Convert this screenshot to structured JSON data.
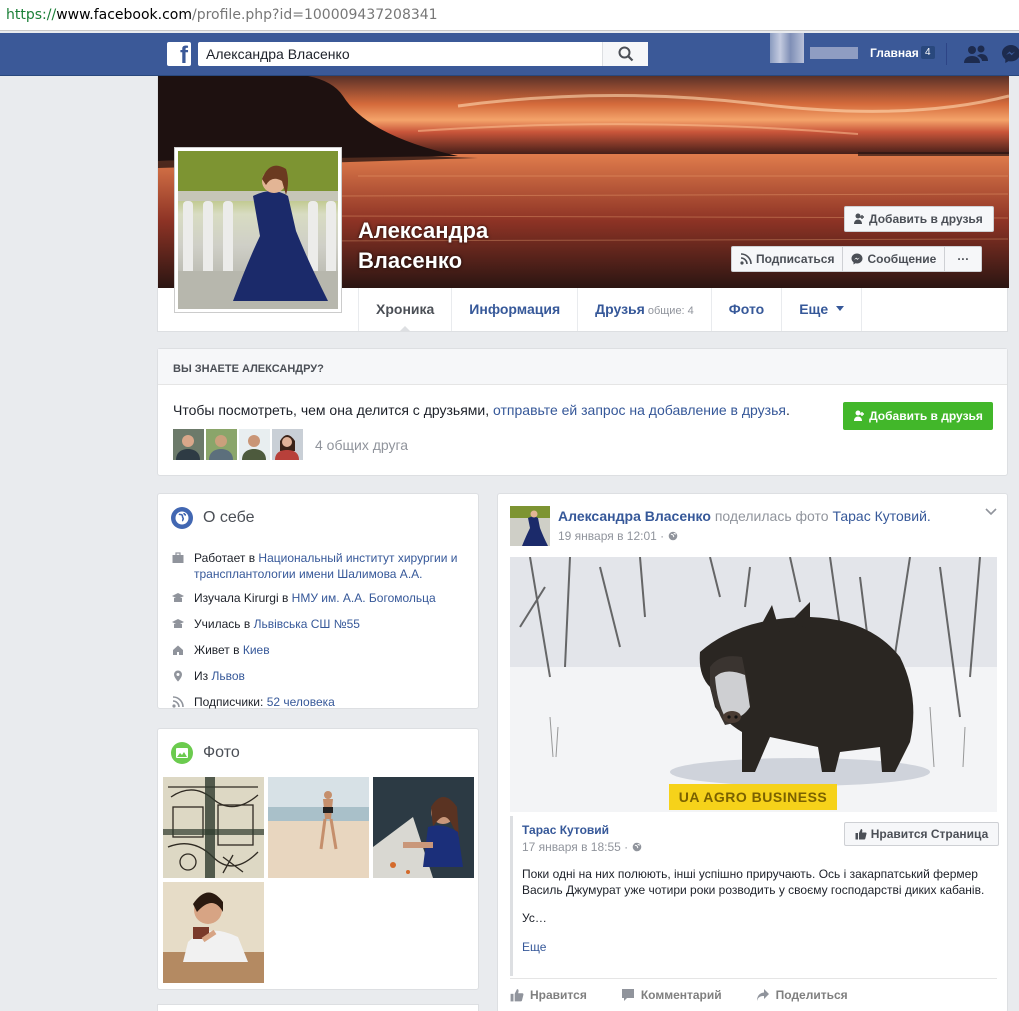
{
  "browser": {
    "url_proto": "https://",
    "url_host": "www.facebook.com",
    "url_path": "/profile.php?id=100009437208341"
  },
  "topnav": {
    "logo": "f",
    "search_value": "Александра Власенко",
    "home_label": "Главная",
    "home_count": "4",
    "icons": [
      "search-icon",
      "friend-requests-icon",
      "messages-icon"
    ]
  },
  "profile": {
    "name_line1": "Александра",
    "name_line2": "Власенко",
    "add_friend_label": "Добавить в друзья",
    "follow_label": "Подписаться",
    "message_label": "Сообщение",
    "more_label": "···"
  },
  "tabs": [
    {
      "label": "Хроника",
      "sub": ""
    },
    {
      "label": "Информация",
      "sub": ""
    },
    {
      "label": "Друзья",
      "sub": "общие: 4"
    },
    {
      "label": "Фото",
      "sub": ""
    },
    {
      "label": "Еще",
      "sub": ""
    }
  ],
  "know": {
    "heading": "ВЫ ЗНАЕТЕ АЛЕКСАНДРУ?",
    "text_prefix": "Чтобы посмотреть, чем она делится с друзьями, ",
    "text_link": "отправьте ей запрос на добавление в друзья",
    "text_suffix": ".",
    "mutual_count": "4 общих друга",
    "add_friend_label": "Добавить в друзья"
  },
  "about": {
    "title": "О себе",
    "rows": [
      {
        "icon": "briefcase-icon",
        "prefix": "Работает в ",
        "link": "Национальный институт хирургии и трансплантологии имени Шалимова А.А."
      },
      {
        "icon": "graduation-cap-icon",
        "prefix": "Изучала Kirurgi в ",
        "link": "НМУ им. А.А. Богомольца"
      },
      {
        "icon": "graduation-cap-icon",
        "prefix": "Училась в ",
        "link": "Львівська СШ №55"
      },
      {
        "icon": "home-icon",
        "prefix": "Живет в ",
        "link": "Киев"
      },
      {
        "icon": "location-pin-icon",
        "prefix": "Из ",
        "link": "Львов"
      },
      {
        "icon": "rss-icon",
        "prefix": "Подписчики: ",
        "link": "52 человека"
      }
    ]
  },
  "photos": {
    "title": "Фото"
  },
  "post": {
    "author": "Александра Власенко",
    "action": " поделилась фото ",
    "target": "Тарас Кутовий.",
    "date": "19 января в 12:01 · ",
    "image_caption": "UA AGRO BUSINESS",
    "shared_name": "Тарас Кутовий",
    "shared_date": "17 января в 18:55 · ",
    "like_page_label": "Нравится Страница",
    "text1": "Поки одні на них полюють, інші успішно приручають. Ось і закарпатський фермер Василь Джумурат уже чотири роки розводить у своєму господарстві диких кабанів.",
    "text2": "Ус…",
    "more_label": "Еще",
    "actions": {
      "like": "Нравится",
      "comment": "Комментарий",
      "share": "Поделиться"
    }
  },
  "colors": {
    "fb_blue": "#3b5998",
    "link": "#365899",
    "green": "#42b72a"
  }
}
